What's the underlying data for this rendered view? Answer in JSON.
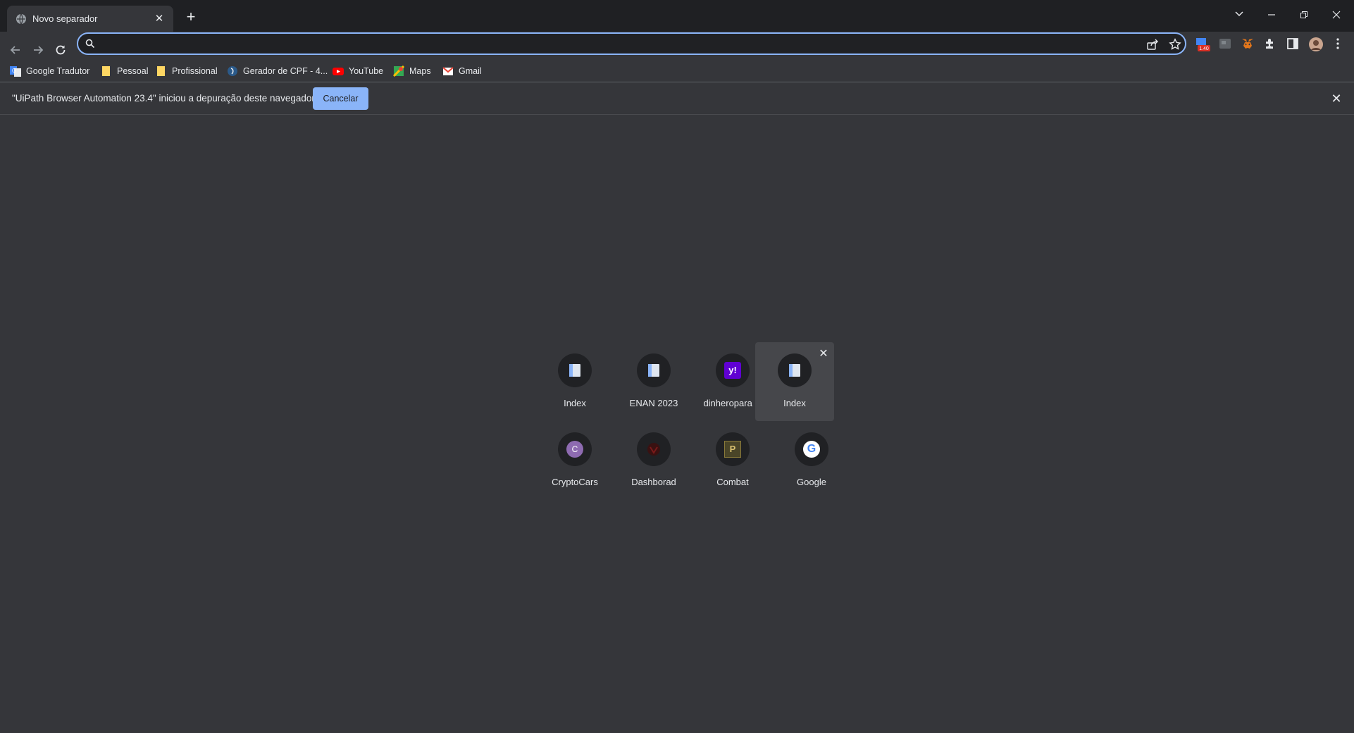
{
  "tab": {
    "title": "Novo separador",
    "close": "✕",
    "new_tab": "+"
  },
  "window": {
    "tablist": "⌄",
    "minimize": "—",
    "restore": "❐",
    "close": "✕"
  },
  "omnibox": {
    "value": "",
    "placeholder": ""
  },
  "extensions": {
    "badge": "1.40"
  },
  "bookmarks": [
    {
      "label": "Google Tradutor",
      "icon": "google-translate-icon"
    },
    {
      "label": "Pessoal",
      "icon": "folder-icon"
    },
    {
      "label": "Profissional",
      "icon": "folder-icon"
    },
    {
      "label": "Gerador de CPF - 4...",
      "icon": "site-icon"
    },
    {
      "label": "YouTube",
      "icon": "youtube-icon"
    },
    {
      "label": "Maps",
      "icon": "maps-icon"
    },
    {
      "label": "Gmail",
      "icon": "gmail-icon"
    }
  ],
  "infobar": {
    "message": "\"UiPath Browser Automation 23.4\" iniciou a depuração deste navegador.",
    "cancel_label": "Cancelar",
    "close": "✕"
  },
  "shortcuts": [
    {
      "label": "Index",
      "icon": "page-icon"
    },
    {
      "label": "ENAN 2023",
      "icon": "page-icon"
    },
    {
      "label": "dinheropara in",
      "icon": "yahoo-icon",
      "glyph": "y!"
    },
    {
      "label": "Index",
      "icon": "page-icon",
      "remove": "✕"
    },
    {
      "label": "CryptoCars",
      "icon": "cryptocars-icon",
      "glyph": "C"
    },
    {
      "label": "Dashborad",
      "icon": "dashboard-icon"
    },
    {
      "label": "Combat",
      "icon": "combat-icon",
      "glyph": "P"
    },
    {
      "label": "Google",
      "icon": "google-icon",
      "glyph": "G"
    }
  ],
  "colors": {
    "accent": "#8ab4f8",
    "background": "#35363a",
    "titlebar": "#1f2023",
    "yahoo": "#6001d2"
  }
}
